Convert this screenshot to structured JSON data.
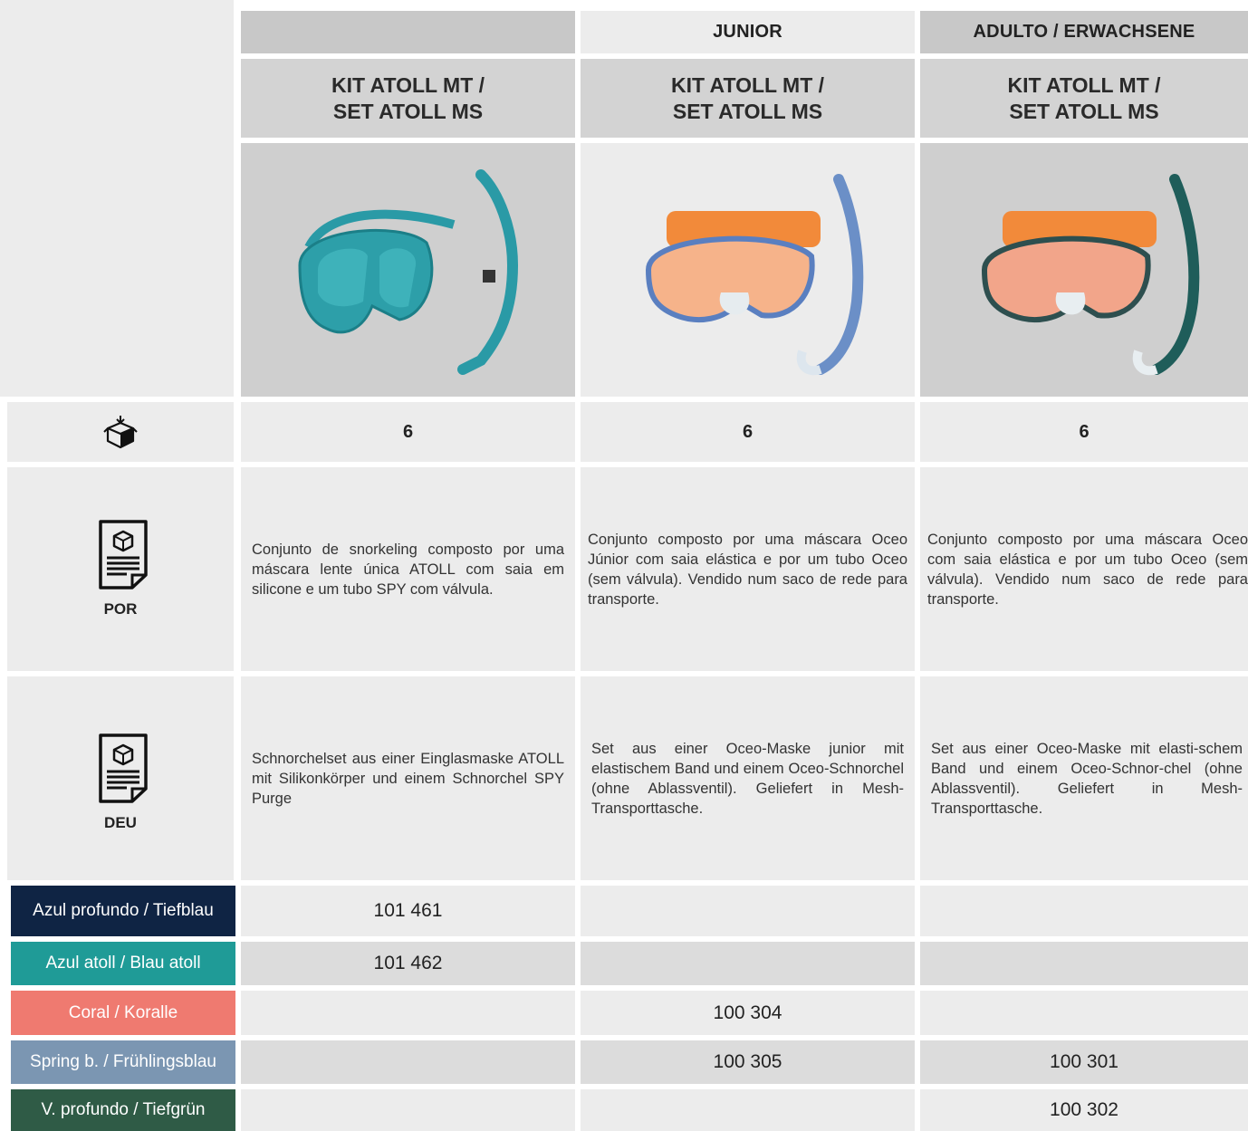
{
  "header": {
    "col1": "",
    "col2": "JUNIOR",
    "col3": "ADULTO / ERWACHSENE"
  },
  "products": [
    {
      "title_line1": "KIT ATOLL MT /",
      "title_line2": "SET ATOLL MS",
      "image": "atoll-mask-snorkel-teal",
      "qty": "6",
      "desc_por": "Conjunto de snorkeling composto por uma máscara lente única ATOLL com saia em silicone e um tubo SPY com válvula.",
      "desc_deu": "Schnorchelset aus einer Einglasmaske ATOLL mit Silikonkörper und einem Schnorchel SPY Purge"
    },
    {
      "title_line1": "KIT ATOLL MT /",
      "title_line2": "SET ATOLL MS",
      "image": "oceo-junior-mask-snorkel-blue",
      "qty": "6",
      "desc_por": "Conjunto composto por uma máscara Oceo Júnior com saia elástica e por um tubo Oceo (sem válvula). Vendido num saco de rede para transporte.",
      "desc_deu": "Set aus einer Oceo-Maske junior mit elastischem Band und einem Oceo-Schnorchel (ohne Ablassventil). Geliefert in Mesh-Transporttasche."
    },
    {
      "title_line1": "KIT ATOLL MT /",
      "title_line2": "SET ATOLL MS",
      "image": "oceo-adult-mask-snorkel-green",
      "qty": "6",
      "desc_por": "Conjunto composto por uma máscara Oceo  com saia elástica e por um tubo Oceo (sem válvula). Vendido num saco de rede para transporte.",
      "desc_deu": "Set aus einer Oceo-Maske mit elasti-schem Band und einem Oceo-Schnor-chel (ohne Ablassventil). Geliefert in Mesh-Transporttasche."
    }
  ],
  "languages": {
    "por": "POR",
    "deu": "DEU"
  },
  "icons": {
    "box": "box-download-icon",
    "doc": "document-icon"
  },
  "colors": [
    {
      "label": "Azul profundo / Tiefblau",
      "hex": "#0f2444",
      "codes": [
        "101 461",
        "",
        ""
      ]
    },
    {
      "label": "Azul atoll / Blau atoll",
      "hex": "#1f9b97",
      "codes": [
        "101 462",
        "",
        ""
      ]
    },
    {
      "label": "Coral / Koralle",
      "hex": "#ef7a70",
      "codes": [
        "",
        "100 304",
        ""
      ]
    },
    {
      "label": "Spring b. / Frühlingsblau",
      "hex": "#7b96b2",
      "codes": [
        "",
        "100 305",
        "100 301"
      ]
    },
    {
      "label": "V. profundo / Tiefgrün",
      "hex": "#2f5b46",
      "codes": [
        "",
        "",
        "100 302"
      ]
    }
  ]
}
